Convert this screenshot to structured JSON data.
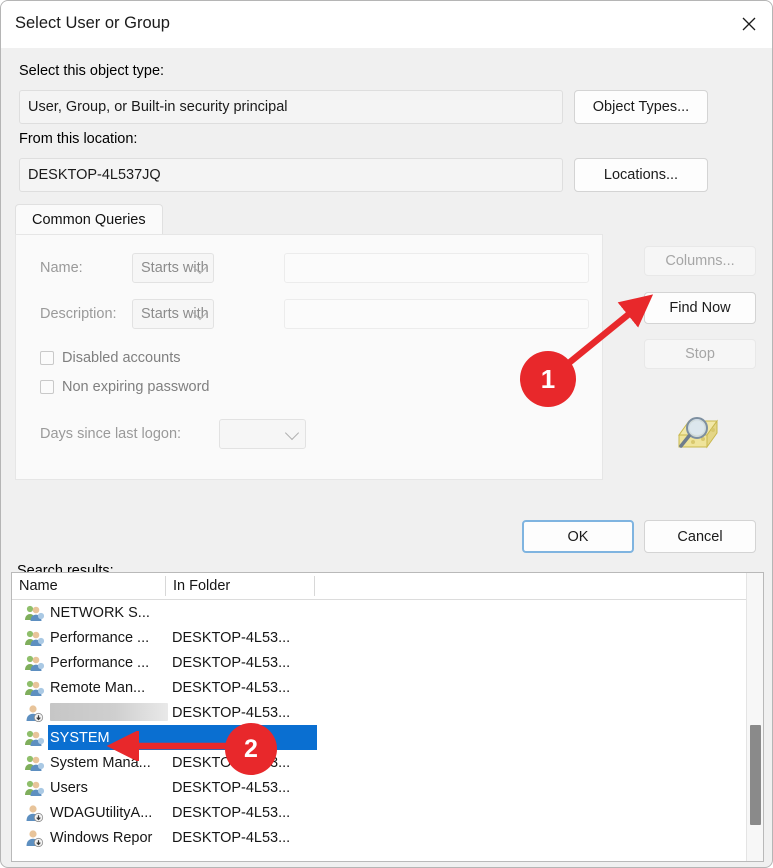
{
  "window": {
    "title": "Select User or Group",
    "close_icon": "close-icon"
  },
  "object_type": {
    "label": "Select this object type:",
    "value": "User, Group, or Built-in security principal",
    "button": "Object Types..."
  },
  "location": {
    "label": "From this location:",
    "value": "DESKTOP-4L537JQ",
    "button": "Locations..."
  },
  "tabs": [
    {
      "label": "Common Queries",
      "selected": true
    }
  ],
  "query": {
    "name_label": "Name:",
    "name_operator": "Starts with",
    "name_value": "",
    "description_label": "Description:",
    "description_operator": "Starts with",
    "description_value": "",
    "disabled_accounts_label": "Disabled accounts",
    "disabled_accounts_checked": false,
    "non_expiring_password_label": "Non expiring password",
    "non_expiring_password_checked": false,
    "days_since_logon_label": "Days since last logon:",
    "days_since_logon_value": ""
  },
  "side_buttons": {
    "columns": "Columns...",
    "find_now": "Find Now",
    "stop": "Stop"
  },
  "dialog_buttons": {
    "ok": "OK",
    "cancel": "Cancel"
  },
  "results": {
    "label": "Search results:",
    "columns": [
      "Name",
      "In Folder"
    ],
    "rows": [
      {
        "name": "NETWORK S...",
        "folder": "",
        "icon": "group-icon",
        "selected": false,
        "redacted": false
      },
      {
        "name": "Performance ...",
        "folder": "DESKTOP-4L53...",
        "icon": "group-icon",
        "selected": false,
        "redacted": false
      },
      {
        "name": "Performance ...",
        "folder": "DESKTOP-4L53...",
        "icon": "group-icon",
        "selected": false,
        "redacted": false
      },
      {
        "name": "Remote Man...",
        "folder": "DESKTOP-4L53...",
        "icon": "group-icon",
        "selected": false,
        "redacted": false
      },
      {
        "name": "",
        "folder": "DESKTOP-4L53...",
        "icon": "user-icon",
        "selected": false,
        "redacted": true
      },
      {
        "name": "SYSTEM",
        "folder": "",
        "icon": "group-icon",
        "selected": true,
        "redacted": false
      },
      {
        "name": "System Mana...",
        "folder": "DESKTOP-4L53...",
        "icon": "group-icon",
        "selected": false,
        "redacted": false
      },
      {
        "name": "Users",
        "folder": "DESKTOP-4L53...",
        "icon": "group-icon",
        "selected": false,
        "redacted": false
      },
      {
        "name": "WDAGUtilityA...",
        "folder": "DESKTOP-4L53...",
        "icon": "user-icon",
        "selected": false,
        "redacted": false
      },
      {
        "name": "Windows Repor",
        "folder": "DESKTOP-4L53...",
        "icon": "user-icon",
        "selected": false,
        "redacted": false
      }
    ]
  },
  "annotations": [
    {
      "number": "1",
      "target": "find-now-button"
    },
    {
      "number": "2",
      "target": "results-row-system"
    }
  ],
  "colors": {
    "annotation_red": "#e8282b",
    "selection_blue": "#0a6fd1",
    "default_button_border": "#7fb4e0",
    "dialog_background": "#f0f0f0"
  }
}
